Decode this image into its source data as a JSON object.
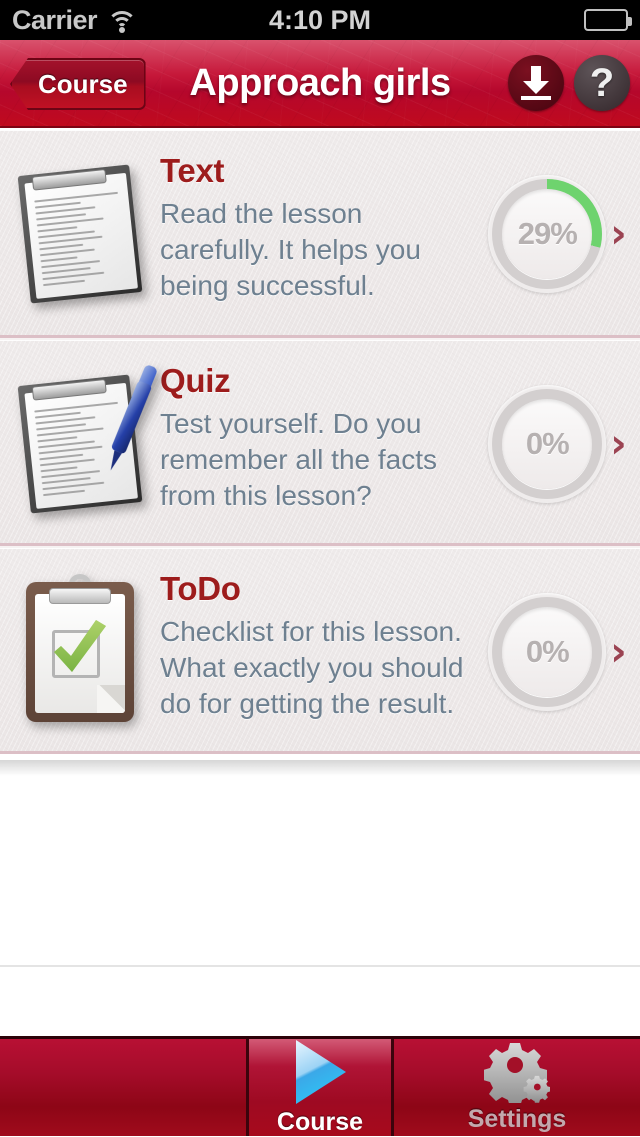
{
  "status_bar": {
    "carrier": "Carrier",
    "wifi_icon": "wifi-icon",
    "time": "4:10 PM",
    "battery_icon": "battery-icon"
  },
  "navbar": {
    "back_label": "Course",
    "title": "Approach girls",
    "download_icon": "download-icon",
    "help_label": "?",
    "brand_red": "#b5072c"
  },
  "rows": [
    {
      "icon": "clipboard-text-icon",
      "title": "Text",
      "description": "Read the lesson carefully. It helps you being successful.",
      "progress_label": "29%",
      "progress_value": 29,
      "progress_color": "#6ed36e",
      "chevron_icon": "chevron-right-icon"
    },
    {
      "icon": "clipboard-pen-icon",
      "title": "Quiz",
      "description": "Test yourself. Do you remember all the facts from this lesson?",
      "progress_label": "0%",
      "progress_value": 0,
      "progress_color": "#6ed36e",
      "chevron_icon": "chevron-right-icon"
    },
    {
      "icon": "clipboard-check-icon",
      "title": "ToDo",
      "description": "Checklist for this lesson. What exactly you should do for getting the result.",
      "progress_label": "0%",
      "progress_value": 0,
      "progress_color": "#6ed36e",
      "chevron_icon": "chevron-right-icon"
    }
  ],
  "tabbar": {
    "tabs": [
      {
        "label": "Course",
        "icon": "play-icon",
        "selected": true
      },
      {
        "label": "Settings",
        "icon": "gear-icon",
        "selected": false
      }
    ]
  }
}
